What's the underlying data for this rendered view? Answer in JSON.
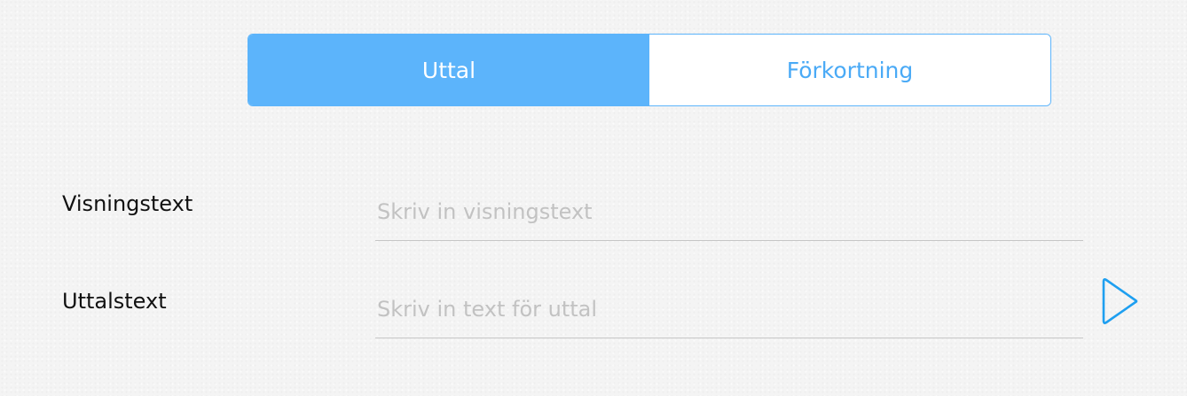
{
  "segmented_control": {
    "items": [
      {
        "label": "Uttal",
        "selected": true
      },
      {
        "label": "Förkortning",
        "selected": false
      }
    ],
    "accent_color": "#5cb4fb"
  },
  "form": {
    "display_text": {
      "label": "Visningstext",
      "value": "",
      "placeholder": "Skriv in visningstext"
    },
    "pronunciation_text": {
      "label": "Uttalstext",
      "value": "",
      "placeholder": "Skriv in text för uttal"
    }
  },
  "icons": {
    "play": "play-icon"
  }
}
